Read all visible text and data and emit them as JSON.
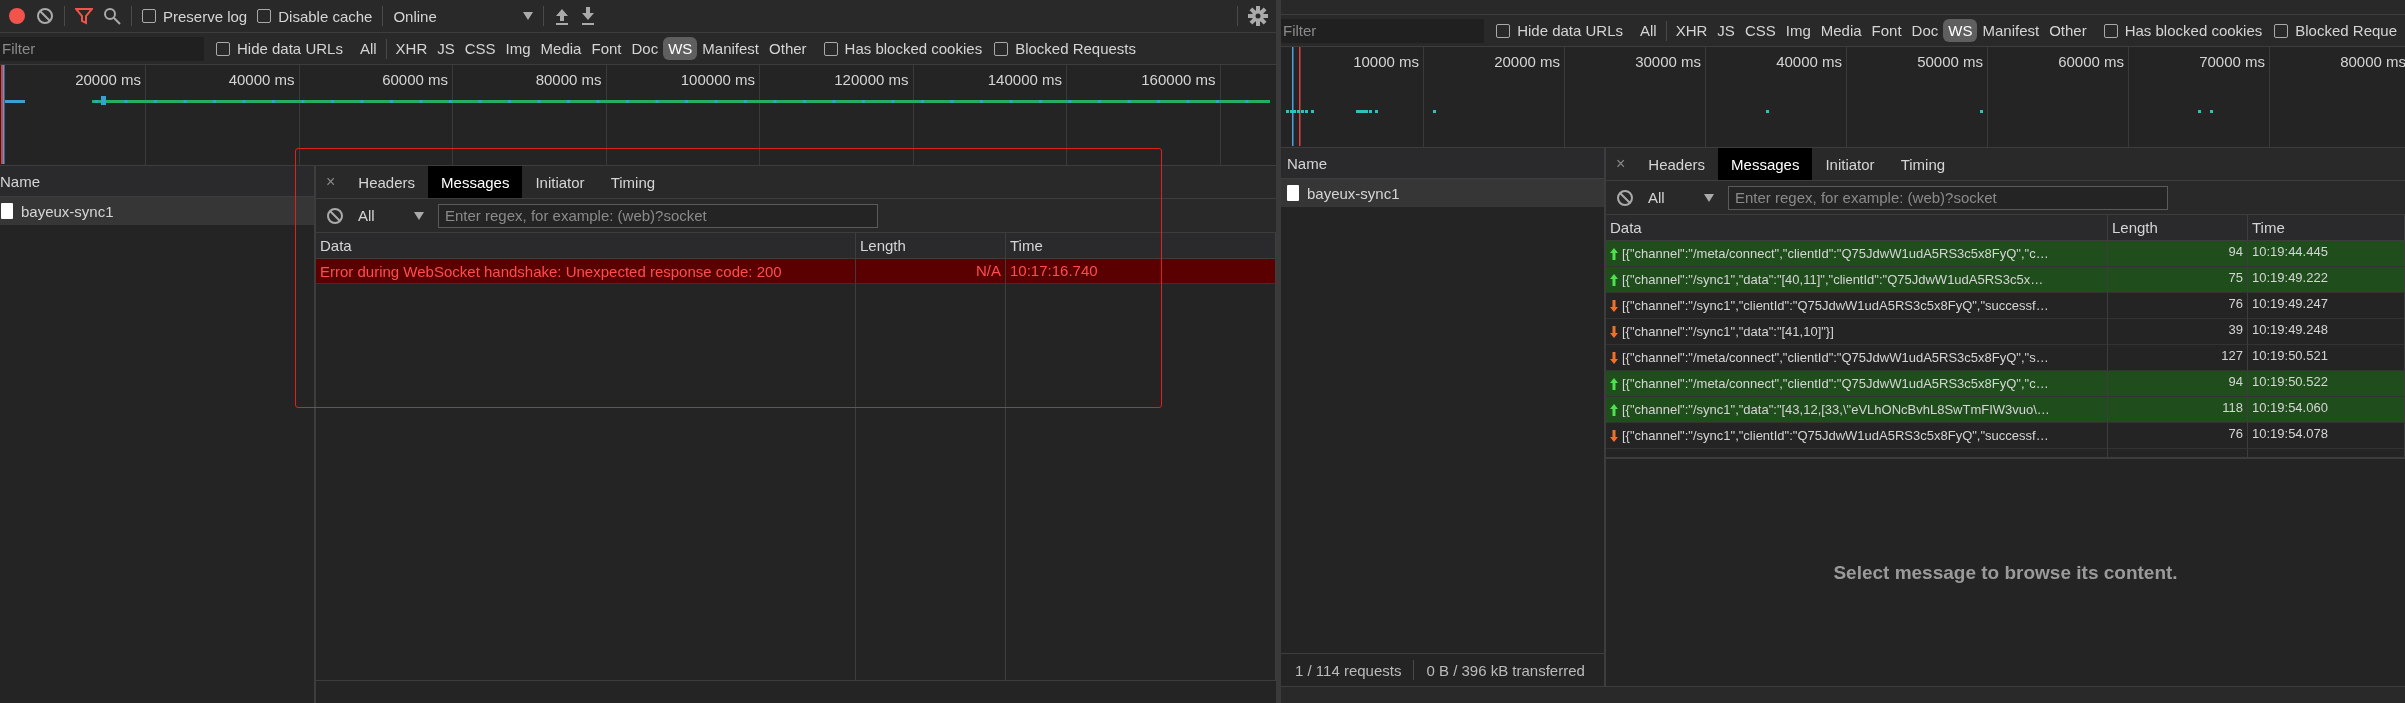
{
  "panels": [
    {
      "toolbar": {
        "checkboxes": [
          {
            "label": "Preserve log",
            "checked": false
          },
          {
            "label": "Disable cache",
            "checked": false
          }
        ],
        "throttling": "Online"
      },
      "filter": {
        "placeholder": "Filter",
        "hide_data_urls": {
          "label": "Hide data URLs",
          "checked": false
        },
        "types": [
          {
            "label": "All",
            "selected": false
          },
          {
            "label": "XHR",
            "selected": false
          },
          {
            "label": "JS",
            "selected": false
          },
          {
            "label": "CSS",
            "selected": false
          },
          {
            "label": "Img",
            "selected": false
          },
          {
            "label": "Media",
            "selected": false
          },
          {
            "label": "Font",
            "selected": false
          },
          {
            "label": "Doc",
            "selected": false
          },
          {
            "label": "WS",
            "selected": true
          },
          {
            "label": "Manifest",
            "selected": false
          },
          {
            "label": "Other",
            "selected": false
          }
        ],
        "extra_checkboxes": [
          {
            "label": "Has blocked cookies",
            "checked": false
          },
          {
            "label": "Blocked Requests",
            "checked": false
          }
        ]
      },
      "timeline": {
        "ticks": [
          "20000 ms",
          "40000 ms",
          "60000 ms",
          "80000 ms",
          "100000 ms",
          "120000 ms",
          "140000 ms",
          "160000 ms"
        ]
      },
      "requests": {
        "column": "Name",
        "items": [
          {
            "name": "bayeux-sync1",
            "selected": true
          }
        ]
      },
      "details": {
        "close": "×",
        "tabs": [
          {
            "label": "Headers",
            "selected": false
          },
          {
            "label": "Messages",
            "selected": true
          },
          {
            "label": "Initiator",
            "selected": false
          },
          {
            "label": "Timing",
            "selected": false
          }
        ],
        "message_filter": {
          "type": "All",
          "placeholder": "Enter regex, for example: (web)?socket"
        },
        "columns": [
          "Data",
          "Length",
          "Time"
        ],
        "messages": [
          {
            "kind": "error",
            "data": "Error during WebSocket handshake: Unexpected response code: 200",
            "length": "N/A",
            "time": "10:17:16.740"
          }
        ]
      },
      "highlight": true
    },
    {
      "filter": {
        "placeholder": "Filter",
        "hide_data_urls": {
          "label": "Hide data URLs",
          "checked": false
        },
        "types": [
          {
            "label": "All",
            "selected": false
          },
          {
            "label": "XHR",
            "selected": false
          },
          {
            "label": "JS",
            "selected": false
          },
          {
            "label": "CSS",
            "selected": false
          },
          {
            "label": "Img",
            "selected": false
          },
          {
            "label": "Media",
            "selected": false
          },
          {
            "label": "Font",
            "selected": false
          },
          {
            "label": "Doc",
            "selected": false
          },
          {
            "label": "WS",
            "selected": true
          },
          {
            "label": "Manifest",
            "selected": false
          },
          {
            "label": "Other",
            "selected": false
          }
        ],
        "extra_checkboxes": [
          {
            "label": "Has blocked cookies",
            "checked": false
          },
          {
            "label": "Blocked Reque",
            "checked": false
          }
        ]
      },
      "timeline": {
        "ticks": [
          "10000 ms",
          "20000 ms",
          "30000 ms",
          "40000 ms",
          "50000 ms",
          "60000 ms",
          "70000 ms",
          "80000 ms"
        ]
      },
      "requests": {
        "column": "Name",
        "items": [
          {
            "name": "bayeux-sync1",
            "selected": true
          }
        ]
      },
      "details": {
        "close": "×",
        "tabs": [
          {
            "label": "Headers",
            "selected": false
          },
          {
            "label": "Messages",
            "selected": true
          },
          {
            "label": "Initiator",
            "selected": false
          },
          {
            "label": "Timing",
            "selected": false
          }
        ],
        "message_filter": {
          "type": "All",
          "placeholder": "Enter regex, for example: (web)?socket"
        },
        "columns": [
          "Data",
          "Length",
          "Time"
        ],
        "messages": [
          {
            "kind": "sent",
            "data": "[{\"channel\":\"/meta/connect\",\"clientId\":\"Q75JdwW1udA5RS3c5x8FyQ\",\"c…",
            "length": "94",
            "time": "10:19:44.445"
          },
          {
            "kind": "sent",
            "data": "[{\"channel\":\"/sync1\",\"data\":\"[40,11]\",\"clientId\":\"Q75JdwW1udA5RS3c5x…",
            "length": "75",
            "time": "10:19:49.222"
          },
          {
            "kind": "received",
            "data": "[{\"channel\":\"/sync1\",\"clientId\":\"Q75JdwW1udA5RS3c5x8FyQ\",\"successf…",
            "length": "76",
            "time": "10:19:49.247"
          },
          {
            "kind": "received",
            "data": "[{\"channel\":\"/sync1\",\"data\":\"[41,10]\"}]",
            "length": "39",
            "time": "10:19:49.248"
          },
          {
            "kind": "received",
            "data": "[{\"channel\":\"/meta/connect\",\"clientId\":\"Q75JdwW1udA5RS3c5x8FyQ\",\"s…",
            "length": "127",
            "time": "10:19:50.521"
          },
          {
            "kind": "sent",
            "data": "[{\"channel\":\"/meta/connect\",\"clientId\":\"Q75JdwW1udA5RS3c5x8FyQ\",\"c…",
            "length": "94",
            "time": "10:19:50.522"
          },
          {
            "kind": "sent",
            "data": "[{\"channel\":\"/sync1\",\"data\":\"[43,12,[33,\\\"eVLhONcBvhL8SwTmFIW3vuo\\…",
            "length": "118",
            "time": "10:19:54.060"
          },
          {
            "kind": "received",
            "data": "[{\"channel\":\"/sync1\",\"clientId\":\"Q75JdwW1udA5RS3c5x8FyQ\",\"successf…",
            "length": "76",
            "time": "10:19:54.078"
          }
        ],
        "empty_hint": "Select message to browse its content."
      },
      "status_bar": [
        "1 / 114 requests",
        "0 B / 396 kB transferred"
      ]
    }
  ]
}
